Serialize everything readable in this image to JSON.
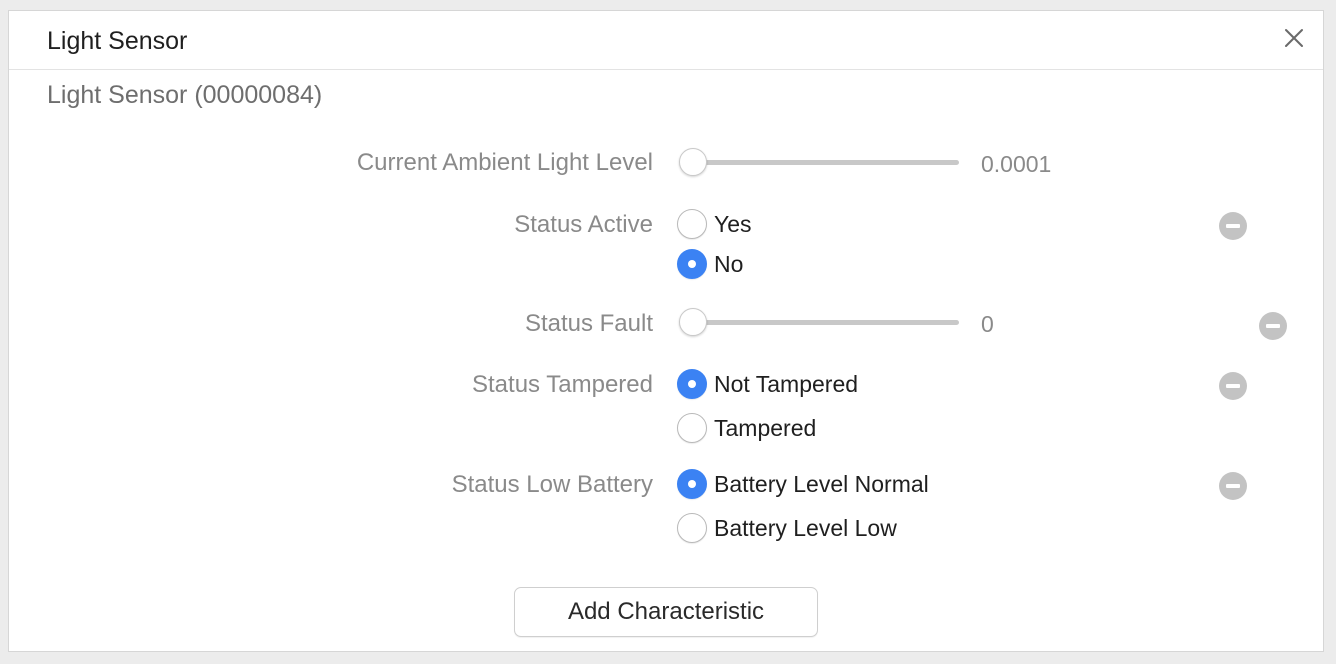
{
  "window": {
    "title": "Light Sensor",
    "close_icon": "close-x-icon"
  },
  "service": {
    "title": "Light Sensor (00000084)"
  },
  "characteristics": {
    "ambient_light": {
      "label": "Current Ambient Light Level",
      "value_text": "0.0001",
      "slider_fraction": 0
    },
    "status_active": {
      "label": "Status Active",
      "options": [
        {
          "label": "Yes",
          "selected": false
        },
        {
          "label": "No",
          "selected": true
        }
      ]
    },
    "status_fault": {
      "label": "Status Fault",
      "value_text": "0",
      "slider_fraction": 0
    },
    "status_tampered": {
      "label": "Status Tampered",
      "options": [
        {
          "label": "Not Tampered",
          "selected": true
        },
        {
          "label": "Tampered",
          "selected": false
        }
      ]
    },
    "status_low_battery": {
      "label": "Status Low Battery",
      "options": [
        {
          "label": "Battery Level Normal",
          "selected": true
        },
        {
          "label": "Battery Level Low",
          "selected": false
        }
      ]
    }
  },
  "actions": {
    "add_label": "Add Characteristic"
  },
  "colors": {
    "accent": "#3b82f3",
    "remove_badge": "#c3c3c3"
  }
}
